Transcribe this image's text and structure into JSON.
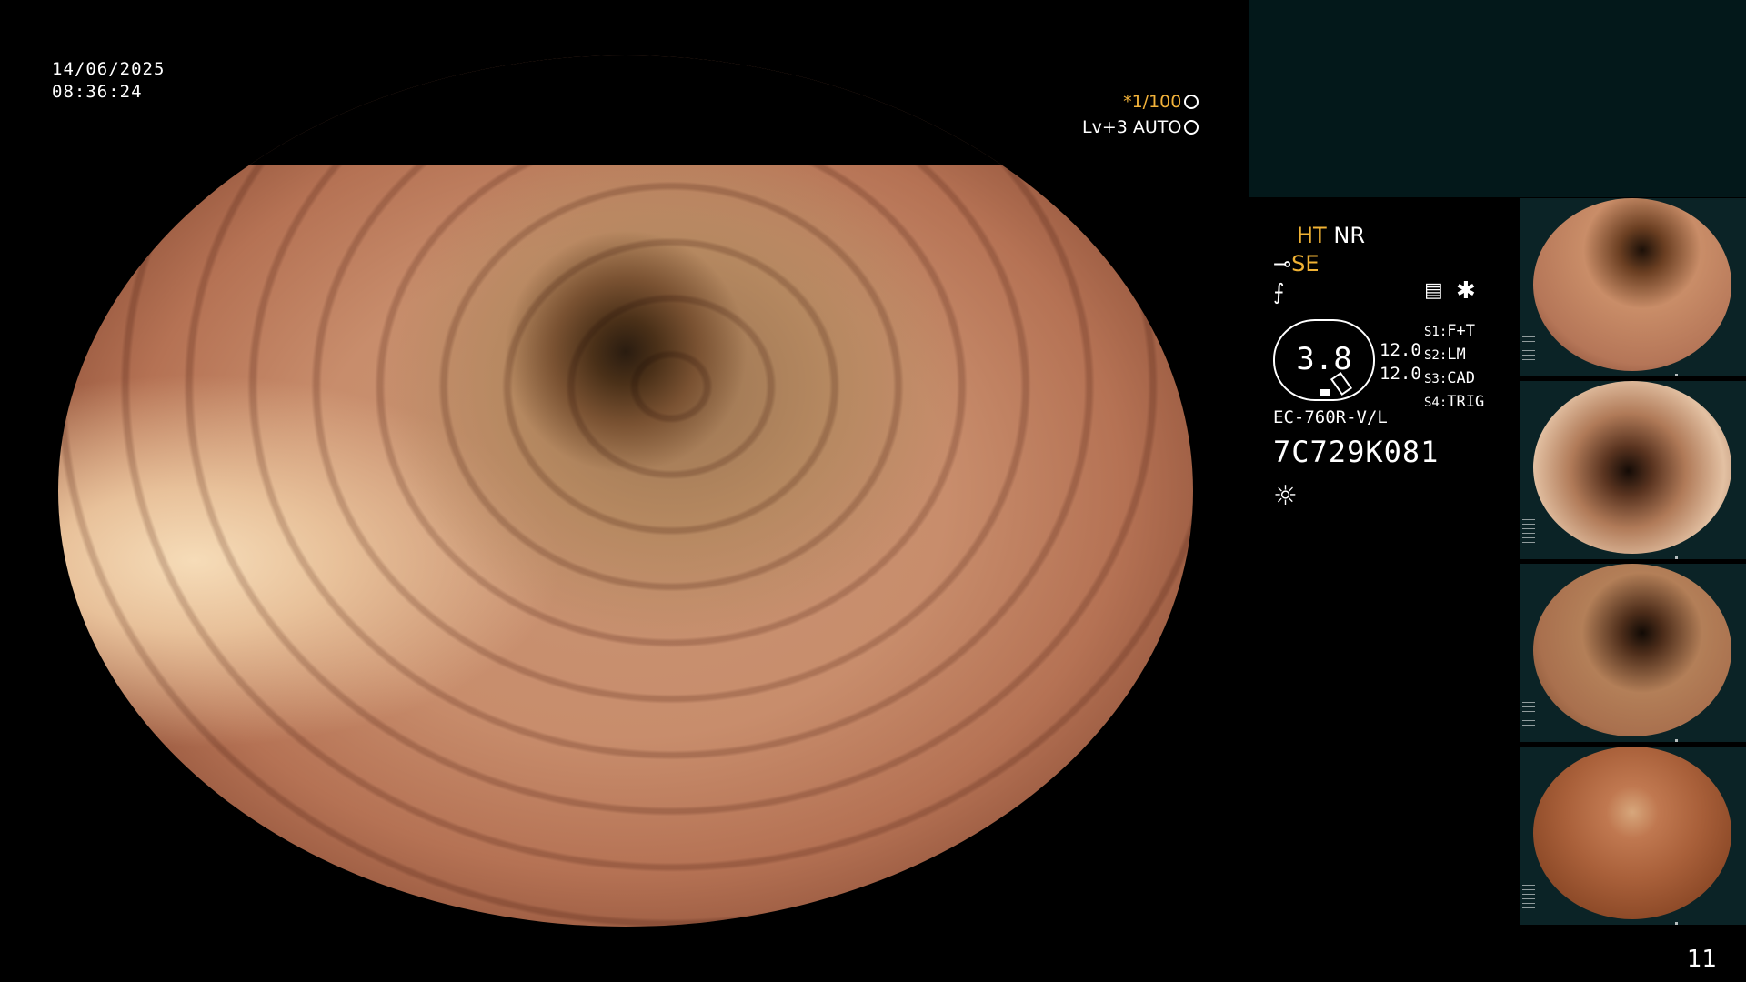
{
  "overlay": {
    "date": "14/06/2025",
    "time": "08:36:24",
    "shutter": "*1/100",
    "level": "Lv+3 AUTO"
  },
  "settings": {
    "ht": "HT",
    "nr": "NR",
    "se": "SE",
    "gauge_value": "3.8",
    "gain_1": "12.0",
    "gain_2": "12.0",
    "slots": [
      {
        "key": "S1:",
        "value": "F+T"
      },
      {
        "key": "S2:",
        "value": "LM"
      },
      {
        "key": "S3:",
        "value": "CAD"
      },
      {
        "key": "S4:",
        "value": "TRIG"
      }
    ],
    "model": "EC-760R-V/L",
    "serial": "7C729K081"
  },
  "icons": {
    "shutter": "aperture-icon",
    "level": "auto-exposure-icon",
    "scope": "scope-tip-icon",
    "signal": "signal-icon",
    "records": "records-icon",
    "freeze": "asterisk-icon",
    "light": "light-source-icon"
  },
  "colors": {
    "accent": "#f2b23a",
    "panel": "#03181a"
  },
  "page_number": "11"
}
